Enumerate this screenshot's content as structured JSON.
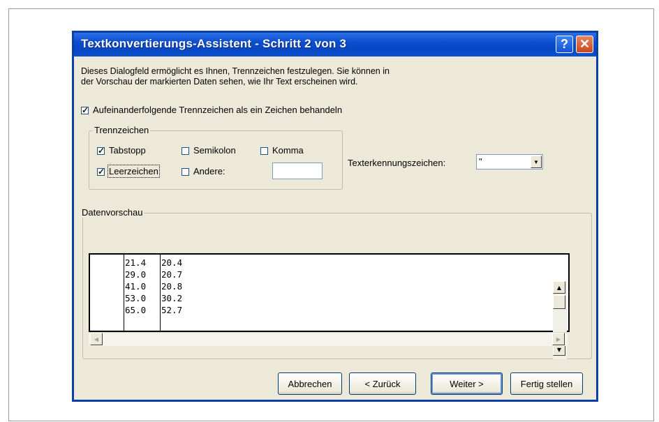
{
  "dialog": {
    "title": "Textkonvertierungs-Assistent - Schritt 2 von 3",
    "help_label": "?",
    "close_label": "✕",
    "intro_line1": "Dieses Dialogfeld ermöglicht es Ihnen, Trennzeichen festzulegen. Sie können in",
    "intro_line2": "der Vorschau der markierten Daten sehen, wie Ihr Text erscheinen wird.",
    "consecutive_label": "Aufeinanderfolgende Trennzeichen als ein Zeichen behandeln",
    "consecutive_checked": true
  },
  "delimiters": {
    "group_label": "Trennzeichen",
    "tab": {
      "label": "Tabstopp",
      "checked": true
    },
    "semicolon": {
      "label": "Semikolon",
      "checked": false
    },
    "comma": {
      "label": "Komma",
      "checked": false
    },
    "space": {
      "label": "Leerzeichen",
      "checked": true
    },
    "other": {
      "label": "Andere:",
      "checked": false,
      "value": ""
    }
  },
  "text_qualifier": {
    "label": "Texterkennungszeichen:",
    "value": "\""
  },
  "preview": {
    "group_label": "Datenvorschau",
    "rows": [
      [
        "21.4",
        "20.4"
      ],
      [
        "29.0",
        "20.7"
      ],
      [
        "41.0",
        "20.8"
      ],
      [
        "53.0",
        "30.2"
      ],
      [
        "65.0",
        "52.7"
      ]
    ]
  },
  "buttons": {
    "cancel": "Abbrechen",
    "back": "< Zurück",
    "next": "Weiter >",
    "finish": "Fertig stellen"
  }
}
